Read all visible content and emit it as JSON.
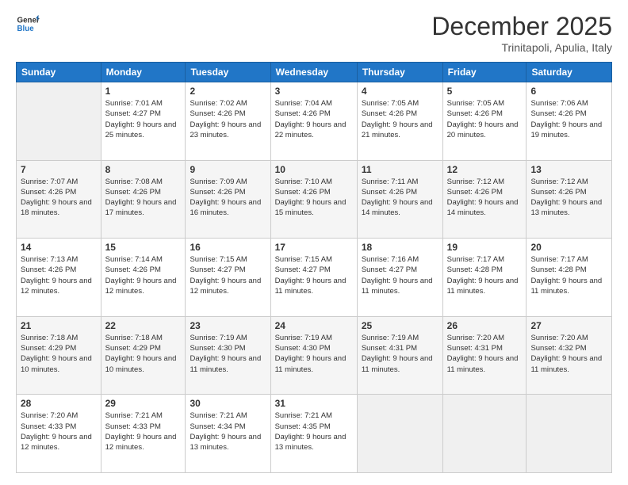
{
  "logo": {
    "general": "General",
    "blue": "Blue"
  },
  "header": {
    "month": "December 2025",
    "location": "Trinitapoli, Apulia, Italy"
  },
  "weekdays": [
    "Sunday",
    "Monday",
    "Tuesday",
    "Wednesday",
    "Thursday",
    "Friday",
    "Saturday"
  ],
  "weeks": [
    [
      {
        "day": "",
        "empty": true
      },
      {
        "day": "1",
        "sunrise": "7:01 AM",
        "sunset": "4:27 PM",
        "daylight": "9 hours and 25 minutes."
      },
      {
        "day": "2",
        "sunrise": "7:02 AM",
        "sunset": "4:26 PM",
        "daylight": "9 hours and 23 minutes."
      },
      {
        "day": "3",
        "sunrise": "7:04 AM",
        "sunset": "4:26 PM",
        "daylight": "9 hours and 22 minutes."
      },
      {
        "day": "4",
        "sunrise": "7:05 AM",
        "sunset": "4:26 PM",
        "daylight": "9 hours and 21 minutes."
      },
      {
        "day": "5",
        "sunrise": "7:05 AM",
        "sunset": "4:26 PM",
        "daylight": "9 hours and 20 minutes."
      },
      {
        "day": "6",
        "sunrise": "7:06 AM",
        "sunset": "4:26 PM",
        "daylight": "9 hours and 19 minutes."
      }
    ],
    [
      {
        "day": "7",
        "sunrise": "7:07 AM",
        "sunset": "4:26 PM",
        "daylight": "9 hours and 18 minutes."
      },
      {
        "day": "8",
        "sunrise": "7:08 AM",
        "sunset": "4:26 PM",
        "daylight": "9 hours and 17 minutes."
      },
      {
        "day": "9",
        "sunrise": "7:09 AM",
        "sunset": "4:26 PM",
        "daylight": "9 hours and 16 minutes."
      },
      {
        "day": "10",
        "sunrise": "7:10 AM",
        "sunset": "4:26 PM",
        "daylight": "9 hours and 15 minutes."
      },
      {
        "day": "11",
        "sunrise": "7:11 AM",
        "sunset": "4:26 PM",
        "daylight": "9 hours and 14 minutes."
      },
      {
        "day": "12",
        "sunrise": "7:12 AM",
        "sunset": "4:26 PM",
        "daylight": "9 hours and 14 minutes."
      },
      {
        "day": "13",
        "sunrise": "7:12 AM",
        "sunset": "4:26 PM",
        "daylight": "9 hours and 13 minutes."
      }
    ],
    [
      {
        "day": "14",
        "sunrise": "7:13 AM",
        "sunset": "4:26 PM",
        "daylight": "9 hours and 12 minutes."
      },
      {
        "day": "15",
        "sunrise": "7:14 AM",
        "sunset": "4:26 PM",
        "daylight": "9 hours and 12 minutes."
      },
      {
        "day": "16",
        "sunrise": "7:15 AM",
        "sunset": "4:27 PM",
        "daylight": "9 hours and 12 minutes."
      },
      {
        "day": "17",
        "sunrise": "7:15 AM",
        "sunset": "4:27 PM",
        "daylight": "9 hours and 11 minutes."
      },
      {
        "day": "18",
        "sunrise": "7:16 AM",
        "sunset": "4:27 PM",
        "daylight": "9 hours and 11 minutes."
      },
      {
        "day": "19",
        "sunrise": "7:17 AM",
        "sunset": "4:28 PM",
        "daylight": "9 hours and 11 minutes."
      },
      {
        "day": "20",
        "sunrise": "7:17 AM",
        "sunset": "4:28 PM",
        "daylight": "9 hours and 11 minutes."
      }
    ],
    [
      {
        "day": "21",
        "sunrise": "7:18 AM",
        "sunset": "4:29 PM",
        "daylight": "9 hours and 10 minutes."
      },
      {
        "day": "22",
        "sunrise": "7:18 AM",
        "sunset": "4:29 PM",
        "daylight": "9 hours and 10 minutes."
      },
      {
        "day": "23",
        "sunrise": "7:19 AM",
        "sunset": "4:30 PM",
        "daylight": "9 hours and 11 minutes."
      },
      {
        "day": "24",
        "sunrise": "7:19 AM",
        "sunset": "4:30 PM",
        "daylight": "9 hours and 11 minutes."
      },
      {
        "day": "25",
        "sunrise": "7:19 AM",
        "sunset": "4:31 PM",
        "daylight": "9 hours and 11 minutes."
      },
      {
        "day": "26",
        "sunrise": "7:20 AM",
        "sunset": "4:31 PM",
        "daylight": "9 hours and 11 minutes."
      },
      {
        "day": "27",
        "sunrise": "7:20 AM",
        "sunset": "4:32 PM",
        "daylight": "9 hours and 11 minutes."
      }
    ],
    [
      {
        "day": "28",
        "sunrise": "7:20 AM",
        "sunset": "4:33 PM",
        "daylight": "9 hours and 12 minutes."
      },
      {
        "day": "29",
        "sunrise": "7:21 AM",
        "sunset": "4:33 PM",
        "daylight": "9 hours and 12 minutes."
      },
      {
        "day": "30",
        "sunrise": "7:21 AM",
        "sunset": "4:34 PM",
        "daylight": "9 hours and 13 minutes."
      },
      {
        "day": "31",
        "sunrise": "7:21 AM",
        "sunset": "4:35 PM",
        "daylight": "9 hours and 13 minutes."
      },
      {
        "day": "",
        "empty": true
      },
      {
        "day": "",
        "empty": true
      },
      {
        "day": "",
        "empty": true
      }
    ]
  ]
}
